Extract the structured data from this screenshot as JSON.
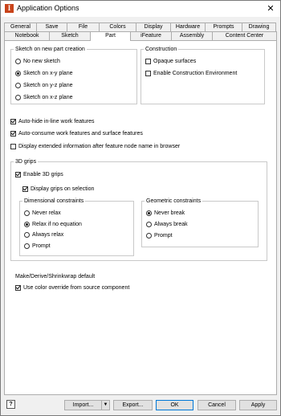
{
  "window": {
    "title": "Application Options",
    "close_glyph": "✕",
    "app_icon_glyph": "I"
  },
  "tabs_row1": [
    {
      "label": "General"
    },
    {
      "label": "Save"
    },
    {
      "label": "File"
    },
    {
      "label": "Colors"
    },
    {
      "label": "Display"
    },
    {
      "label": "Hardware"
    },
    {
      "label": "Prompts"
    },
    {
      "label": "Drawing"
    }
  ],
  "tabs_row2": [
    {
      "label": "Notebook"
    },
    {
      "label": "Sketch"
    },
    {
      "label": "Part",
      "active": true
    },
    {
      "label": "iFeature"
    },
    {
      "label": "Assembly"
    },
    {
      "label": "Content Center"
    }
  ],
  "sketch_group": {
    "title": "Sketch on new part creation",
    "options": [
      {
        "label": "No new sketch",
        "checked": false
      },
      {
        "label": "Sketch on x-y plane",
        "checked": true
      },
      {
        "label": "Sketch on y-z plane",
        "checked": false
      },
      {
        "label": "Sketch on x-z plane",
        "checked": false
      }
    ]
  },
  "construction_group": {
    "title": "Construction",
    "options": [
      {
        "label": "Opaque surfaces",
        "checked": false
      },
      {
        "label": "Enable Construction Environment",
        "checked": false
      }
    ]
  },
  "general_options": [
    {
      "label": "Auto-hide in-line work features",
      "checked": true
    },
    {
      "label": "Auto-consume work features and surface features",
      "checked": true
    },
    {
      "label": "Display extended information after feature node name in browser",
      "checked": false
    }
  ],
  "grips_group": {
    "title": "3D grips",
    "enable": {
      "label": "Enable 3D grips",
      "checked": true
    },
    "display": {
      "label": "Display grips on selection",
      "checked": true
    },
    "dimensional": {
      "title": "Dimensional constraints",
      "options": [
        {
          "label": "Never relax",
          "checked": false
        },
        {
          "label": "Relax if no equation",
          "checked": true
        },
        {
          "label": "Always relax",
          "checked": false
        },
        {
          "label": "Prompt",
          "checked": false
        }
      ]
    },
    "geometric": {
      "title": "Geometric constraints",
      "options": [
        {
          "label": "Never break",
          "checked": true
        },
        {
          "label": "Always break",
          "checked": false
        },
        {
          "label": "Prompt",
          "checked": false
        }
      ]
    }
  },
  "make_derive": {
    "title": "Make/Derive/Shrinkwrap default",
    "option": {
      "label": "Use color override from source component",
      "checked": true
    }
  },
  "bottom": {
    "help_glyph": "?",
    "import_label": "Import...",
    "import_arrow": "▼",
    "export_label": "Export...",
    "ok_label": "OK",
    "cancel_label": "Cancel",
    "apply_label": "Apply"
  }
}
